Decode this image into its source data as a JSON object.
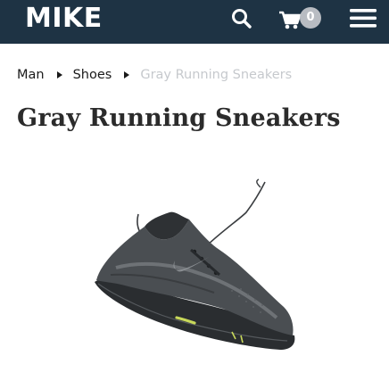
{
  "header": {
    "logo": "MIKE",
    "cart_count": "0",
    "bg_color": "#1e3344"
  },
  "icons": {
    "search": "search-icon",
    "cart": "cart-icon",
    "menu": "hamburger-menu-icon"
  },
  "breadcrumb": {
    "items": [
      {
        "label": "Man"
      },
      {
        "label": "Shoes"
      }
    ],
    "current": "Gray Running Sneakers"
  },
  "product": {
    "title": "Gray Running Sneakers",
    "image": "gray-running-sneaker-image"
  }
}
